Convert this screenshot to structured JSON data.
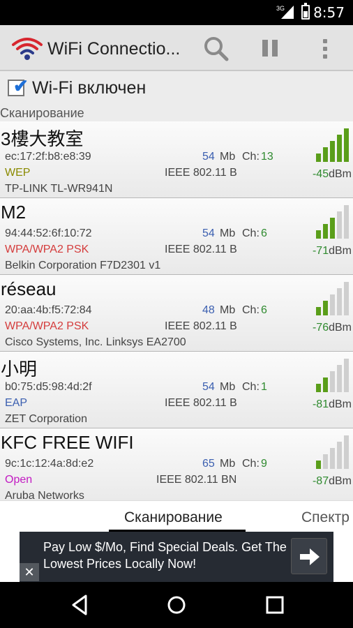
{
  "status_bar": {
    "network": "3G",
    "time": "8:57",
    "icons": [
      "signal-icon",
      "battery-icon"
    ]
  },
  "action_bar": {
    "title": "WiFi Connectio...",
    "icons": [
      "wifi-logo-icon",
      "search-icon",
      "pause-icon",
      "overflow-menu-icon"
    ]
  },
  "wifi_toggle": {
    "label": "Wi-Fi включен",
    "checked": true
  },
  "section_header": "Сканирование",
  "networks": [
    {
      "ssid": "3樓大教室",
      "mac": "ec:17:2f:b8:e8:39",
      "speed": "54",
      "speed_unit": "Mb",
      "channel_label": "Ch:",
      "channel": "13",
      "security": "WEP",
      "security_color": "#8a8a00",
      "standard": "IEEE 802.11 B",
      "vendor": "TP-LINK TL-WR941N",
      "dbm": "-45",
      "dbm_unit": "dBm",
      "signal_level": 5
    },
    {
      "ssid": "M2",
      "mac": "94:44:52:6f:10:72",
      "speed": "54",
      "speed_unit": "Mb",
      "channel_label": "Ch:",
      "channel": "6",
      "security": "WPA/WPA2 PSK",
      "security_color": "#d43c3c",
      "standard": "IEEE 802.11 B",
      "vendor": "Belkin Corporation F7D2301 v1",
      "dbm": "-71",
      "dbm_unit": "dBm",
      "signal_level": 3
    },
    {
      "ssid": "réseau",
      "mac": "20:aa:4b:f5:72:84",
      "speed": "48",
      "speed_unit": "Mb",
      "channel_label": "Ch:",
      "channel": "6",
      "security": "WPA/WPA2 PSK",
      "security_color": "#d43c3c",
      "standard": "IEEE 802.11 B",
      "vendor": "Cisco Systems, Inc. Linksys EA2700",
      "dbm": "-76",
      "dbm_unit": "dBm",
      "signal_level": 2
    },
    {
      "ssid": "小明",
      "mac": "b0:75:d5:98:4d:2f",
      "speed": "54",
      "speed_unit": "Mb",
      "channel_label": "Ch:",
      "channel": "1",
      "security": "EAP",
      "security_color": "#3b5fb0",
      "standard": "IEEE 802.11 B",
      "vendor": "ZET Corporation",
      "dbm": "-81",
      "dbm_unit": "dBm",
      "signal_level": 2
    },
    {
      "ssid": "KFC FREE WIFI",
      "mac": "9c:1c:12:4a:8d:e2",
      "speed": "65",
      "speed_unit": "Mb",
      "channel_label": "Ch:",
      "channel": "9",
      "security": "Open",
      "security_color": "#c21ac2",
      "standard": "IEEE 802.11 BN",
      "vendor": "Aruba Networks",
      "dbm": "-87",
      "dbm_unit": "dBm",
      "signal_level": 1
    }
  ],
  "tabs": [
    {
      "label": "Сканирование",
      "selected": true
    },
    {
      "label": "Спектр",
      "selected": false
    }
  ],
  "ad": {
    "text": "Pay Low $/Mo, Find Special Deals. Get The Lowest Prices Locally Now!",
    "close_glyph": "✕",
    "icons": [
      "arrow-right-icon",
      "close-icon"
    ]
  },
  "nav_bar": {
    "icons": [
      "back-icon",
      "home-icon",
      "recents-icon"
    ]
  },
  "colors": {
    "signal_on": "#5a9e1a",
    "signal_off": "#cfcfcf",
    "accent_blue": "#3b5fb0",
    "channel_green": "#2f8a2f"
  }
}
